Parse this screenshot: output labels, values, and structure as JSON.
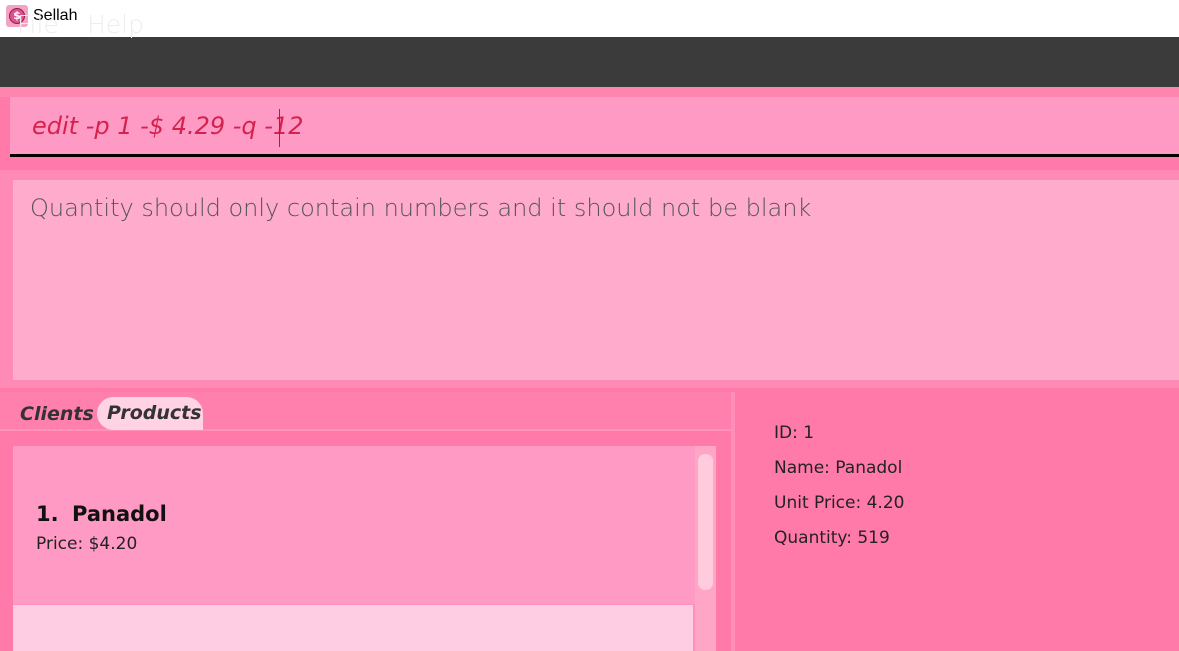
{
  "window": {
    "title": "Sellah",
    "icon": "dollar-coin-icon"
  },
  "menu": {
    "file": "File",
    "help": "Help"
  },
  "command": {
    "value": "edit -p 1 -$ 4.29 -q -12"
  },
  "result": {
    "message": "Quantity should only contain numbers and it should not be blank"
  },
  "tabs": {
    "clients": "Clients",
    "products": "Products",
    "selected": "Products"
  },
  "product_list": {
    "items": [
      {
        "index": "1.",
        "name": "Panadol",
        "price": "Price: $4.20"
      }
    ]
  },
  "details": {
    "id": "ID: 1",
    "name": "Name: Panadol",
    "unit_price": "Unit Price: 4.20",
    "quantity": "Quantity: 519"
  },
  "colors": {
    "menubar": "#3b3b3b",
    "background": "#ff7aa8",
    "command_text": "#d4224e"
  }
}
